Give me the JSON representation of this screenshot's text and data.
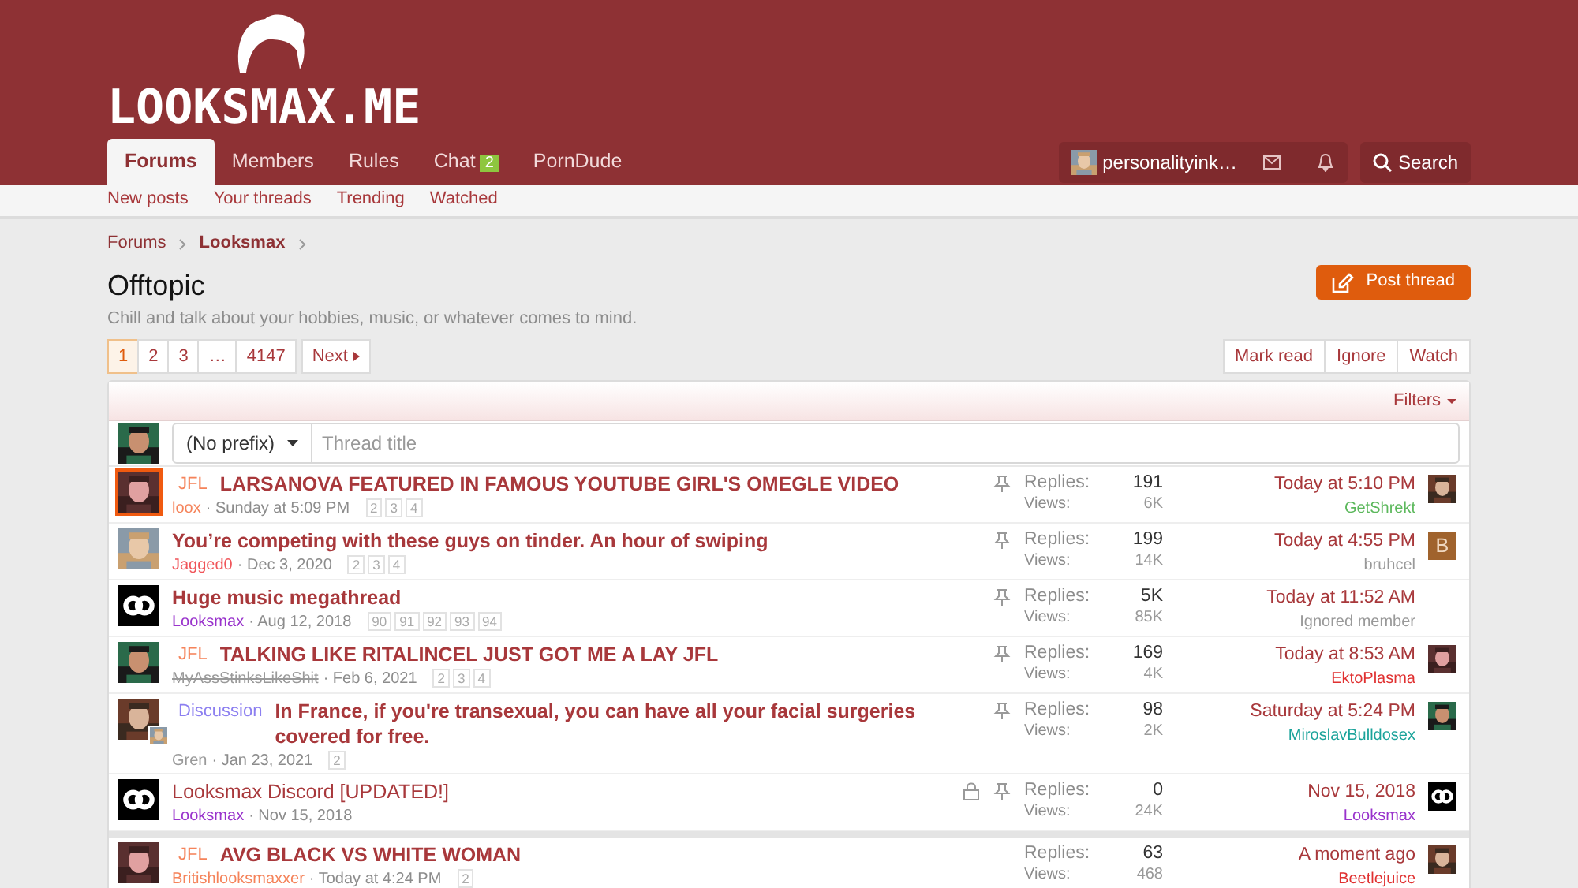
{
  "logo": {
    "text": "LOOKSMAX.ME"
  },
  "nav_tabs": [
    {
      "label": "Forums",
      "selected": true
    },
    {
      "label": "Members",
      "selected": false
    },
    {
      "label": "Rules",
      "selected": false
    },
    {
      "label": "Chat",
      "selected": false,
      "badge": "2"
    },
    {
      "label": "PornDude",
      "selected": false
    }
  ],
  "account": {
    "username": "personalityink…"
  },
  "search": {
    "label": "Search"
  },
  "sub_nav": [
    "New posts",
    "Your threads",
    "Trending",
    "Watched"
  ],
  "breadcrumbs": [
    {
      "label": "Forums",
      "current": false
    },
    {
      "label": "Looksmax",
      "current": true
    }
  ],
  "page_title": "Offtopic",
  "description": "Chill and talk about your hobbies, music, or whatever comes to mind.",
  "post_thread_button": "Post thread",
  "pagination": {
    "pages": [
      {
        "label": "1",
        "selected": true
      },
      {
        "label": "2",
        "selected": false
      },
      {
        "label": "3",
        "selected": false
      },
      {
        "label": "…",
        "selected": false
      },
      {
        "label": "4147",
        "selected": false
      }
    ],
    "next": "Next"
  },
  "actions": [
    "Mark read",
    "Ignore",
    "Watch"
  ],
  "filters": "Filters",
  "new_thread": {
    "prefix": "(No prefix)",
    "placeholder": "Thread title"
  },
  "threads": [
    {
      "avatar": {
        "kind": "picture",
        "highlighted": true
      },
      "prefix": {
        "label": "JFL",
        "color": "#f5835a"
      },
      "title": "LARSANOVA FEATURED IN FAMOUS YOUTUBE GIRL'S OMEGLE VIDEO",
      "unread": true,
      "author": {
        "name": "loox",
        "color": "#f5835a",
        "banned": false
      },
      "date": "· Sunday at 5:09 PM",
      "pages": [
        "2",
        "3",
        "4"
      ],
      "locked": false,
      "sticky": true,
      "replies_label": "Replies:",
      "replies": "191",
      "views_label": "Views:",
      "views": "6K",
      "last_date": "Today at 5:10 PM",
      "last_user": {
        "name": "GetShrekt",
        "color": "#5cb85c"
      },
      "last_avatar": {
        "kind": "picture"
      }
    },
    {
      "avatar": {
        "kind": "picture"
      },
      "title": "You’re competing with these guys on tinder. An hour of swiping",
      "unread": true,
      "author": {
        "name": "Jagged0",
        "color": "#f0555a",
        "banned": false
      },
      "date": "· Dec 3, 2020",
      "pages": [
        "2",
        "3",
        "4"
      ],
      "locked": false,
      "sticky": true,
      "replies_label": "Replies:",
      "replies": "199",
      "views_label": "Views:",
      "views": "14K",
      "last_date": "Today at 4:55 PM",
      "last_user": {
        "name": "bruhcel",
        "color": "#999999"
      },
      "last_avatar": {
        "kind": "letter",
        "letter": "B"
      }
    },
    {
      "avatar": {
        "kind": "logo"
      },
      "title": "Huge music megathread",
      "unread": true,
      "author": {
        "name": "Looksmax",
        "color": "#9933cc",
        "banned": false
      },
      "date": "· Aug 12, 2018",
      "pages": [
        "90",
        "91",
        "92",
        "93",
        "94"
      ],
      "locked": false,
      "sticky": true,
      "replies_label": "Replies:",
      "replies": "5K",
      "views_label": "Views:",
      "views": "85K",
      "last_date": "Today at 11:52 AM",
      "last_user": {
        "name": "Ignored member",
        "color": "#999999"
      }
    },
    {
      "avatar": {
        "kind": "picture"
      },
      "prefix": {
        "label": "JFL",
        "color": "#f5835a"
      },
      "title": "TALKING LIKE RITALINCEL JUST GOT ME A LAY JFL",
      "unread": true,
      "author": {
        "name": "MyAssStinksLikeShit",
        "color": "#999999",
        "banned": true
      },
      "date": "· Feb 6, 2021",
      "pages": [
        "2",
        "3",
        "4"
      ],
      "locked": false,
      "sticky": true,
      "replies_label": "Replies:",
      "replies": "169",
      "views_label": "Views:",
      "views": "4K",
      "last_date": "Today at 8:53 AM",
      "last_user": {
        "name": "EktoPlasma",
        "color": "#e03030"
      },
      "last_avatar": {
        "kind": "picture"
      }
    },
    {
      "avatar": {
        "kind": "pair"
      },
      "prefix": {
        "label": "Discussion",
        "color": "#8c7ff0"
      },
      "title": "In France, if you're transexual, you can have all your facial surgeries covered for free.",
      "unread": true,
      "author": {
        "name": "Gren",
        "color": "#999999",
        "banned": false
      },
      "date": "· Jan 23, 2021",
      "pages": [
        "2"
      ],
      "locked": false,
      "sticky": true,
      "replies_label": "Replies:",
      "replies": "98",
      "views_label": "Views:",
      "views": "2K",
      "last_date": "Saturday at 5:24 PM",
      "last_user": {
        "name": "MiroslavBulldosex",
        "color": "#1aa39a"
      },
      "last_avatar": {
        "kind": "picture"
      }
    },
    {
      "avatar": {
        "kind": "logo"
      },
      "title": "Looksmax Discord [UPDATED!]",
      "unread": false,
      "author": {
        "name": "Looksmax",
        "color": "#9933cc",
        "banned": false
      },
      "date": "· Nov 15, 2018",
      "locked": true,
      "sticky": true,
      "replies_label": "Replies:",
      "replies": "0",
      "views_label": "Views:",
      "views": "24K",
      "last_date": "Nov 15, 2018",
      "last_user": {
        "name": "Looksmax",
        "color": "#9933cc"
      },
      "last_avatar": {
        "kind": "logo"
      }
    },
    {
      "avatar": {
        "kind": "picture"
      },
      "prefix": {
        "label": "JFL",
        "color": "#f5835a"
      },
      "title": "AVG BLACK VS WHITE WOMAN",
      "unread": true,
      "author": {
        "name": "Britishlooksmaxxer",
        "color": "#f5835a",
        "banned": false
      },
      "date": "· Today at 4:24 PM",
      "pages": [
        "2"
      ],
      "locked": false,
      "sticky": false,
      "replies_label": "Replies:",
      "replies": "63",
      "views_label": "Views:",
      "views": "468",
      "last_date": "A moment ago",
      "last_user": {
        "name": "Beetlejuice",
        "color": "#e03030"
      },
      "last_avatar": {
        "kind": "picture"
      }
    }
  ]
}
